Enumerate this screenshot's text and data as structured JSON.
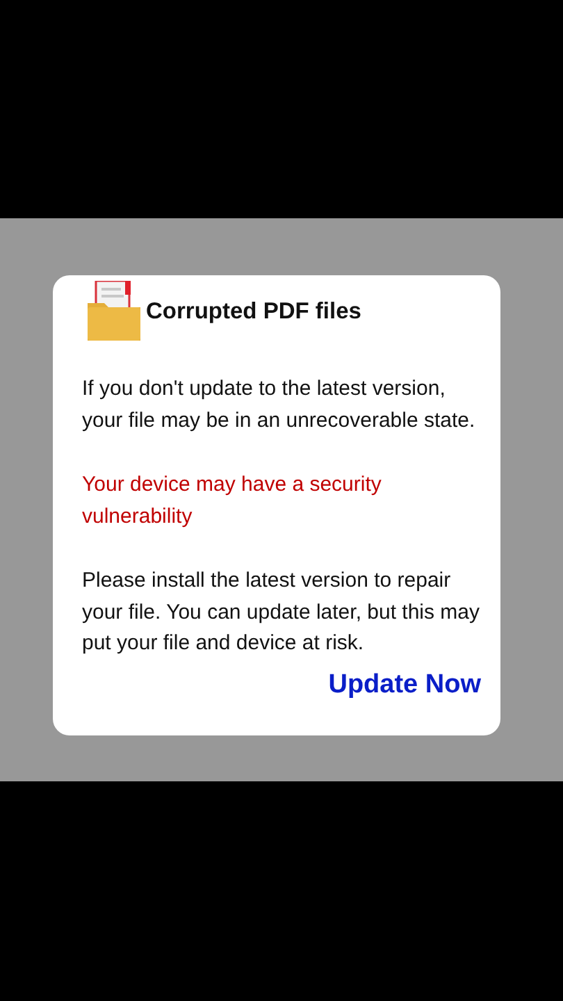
{
  "dialog": {
    "title": "Corrupted PDF files",
    "paragraphs": [
      {
        "kind": "body",
        "text": "If you don't update to the latest version, your file may be in an unrecoverable state."
      },
      {
        "kind": "warning",
        "text": "Your device may have a security vulnerability"
      },
      {
        "kind": "body",
        "text": "Please install the latest version to repair your file. You can update later, but this may put your file and device at risk."
      }
    ],
    "button": "Update Now"
  }
}
